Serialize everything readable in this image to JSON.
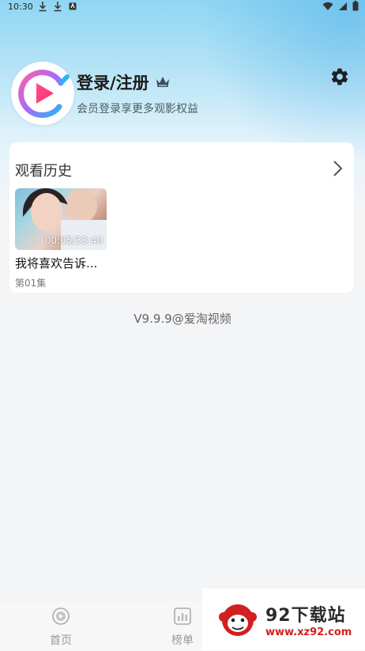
{
  "status_bar": {
    "time": "10:30",
    "left_icons": [
      "download-icon",
      "download-icon",
      "app-notification-icon"
    ],
    "right_icons": [
      "wifi-icon",
      "signal-icon",
      "battery-icon"
    ]
  },
  "profile": {
    "login_title": "登录/注册",
    "subtitle": "会员登录享更多观影权益",
    "avatar_icon": "play-logo-icon",
    "vip_icon": "crown-icon",
    "settings_icon": "gear-icon"
  },
  "history": {
    "title": "观看历史",
    "more_icon": "chevron-right-icon",
    "items": [
      {
        "title": "我将喜欢告诉...",
        "progress": "00:05/33:40",
        "episode": "第01集"
      }
    ]
  },
  "version_text": "V9.9.9@爱淘视频",
  "tabbar": {
    "tabs": [
      {
        "label": "首页",
        "icon": "home-icon"
      },
      {
        "label": "榜单",
        "icon": "chart-icon"
      }
    ]
  },
  "watermark": {
    "title": "92下载站",
    "url": "www.xz92.com"
  },
  "colors": {
    "header_gradient_top": "#8fd6f3",
    "page_bg": "#f4f5f7",
    "watermark_url": "#d21f1f"
  }
}
